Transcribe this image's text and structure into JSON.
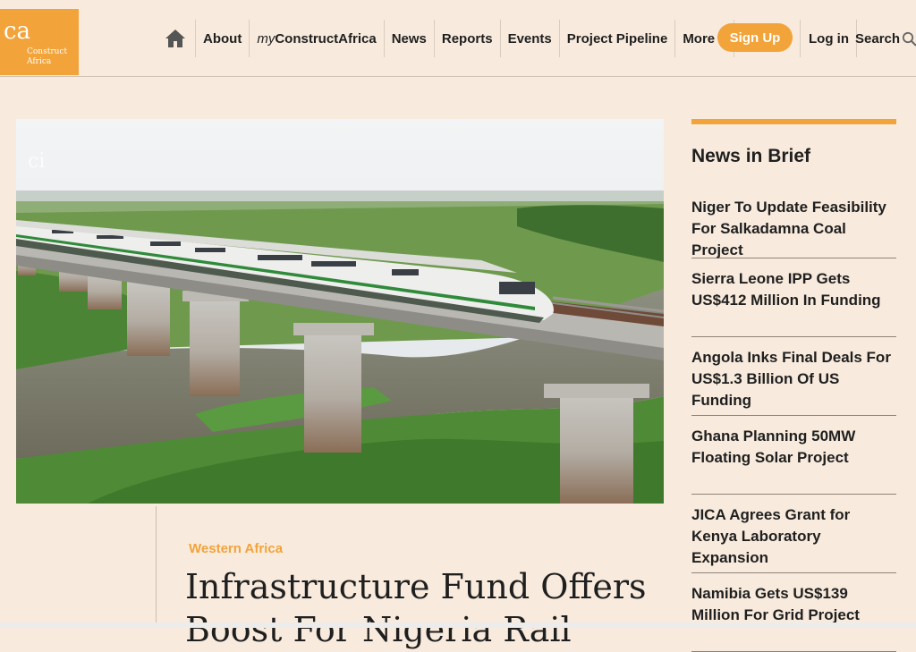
{
  "brand": {
    "logo_mark": "ca",
    "logo_text_line1": "Construct",
    "logo_text_line2": "Africa",
    "accent_color": "#f2a33a",
    "background_color": "#f8ebdd"
  },
  "nav": {
    "home_icon": "home-icon",
    "items": [
      {
        "label": "About"
      },
      {
        "label_prefix": "my",
        "label": "ConstructAfrica"
      },
      {
        "label": "News"
      },
      {
        "label": "Reports"
      },
      {
        "label": "Events"
      },
      {
        "label": "Project Pipeline"
      },
      {
        "label": "More"
      }
    ],
    "signup_label": "Sign Up",
    "login_label": "Log in",
    "search_label": "Search",
    "search_icon": "search-icon"
  },
  "hero": {
    "image_alt": "White passenger train crossing an elevated rail bridge over a river through green countryside",
    "watermark": "ci"
  },
  "article": {
    "region": "Western Africa",
    "headline": "Infrastructure Fund Offers Boost For Nigeria Rail"
  },
  "sidebar": {
    "title": "News in Brief",
    "items": [
      {
        "title": "Niger To Update Feasibility For Salkadamna Coal Project"
      },
      {
        "title": "Sierra Leone IPP Gets US$412 Million In Funding"
      },
      {
        "title": "Angola Inks Final Deals For US$1.3 Billion Of US Funding"
      },
      {
        "title": "Ghana Planning 50MW Floating Solar Project"
      },
      {
        "title": "JICA Agrees Grant for Kenya Laboratory Expansion"
      },
      {
        "title": "Namibia Gets US$139 Million For Grid Project"
      }
    ]
  }
}
